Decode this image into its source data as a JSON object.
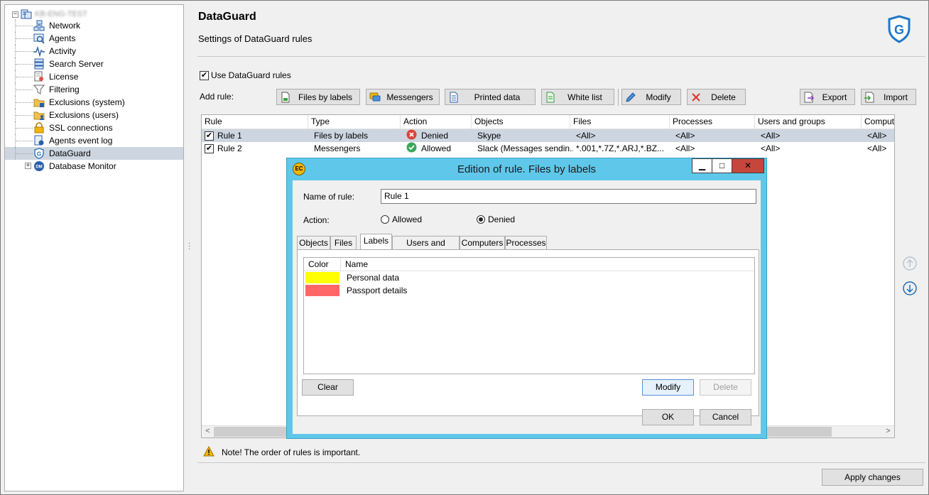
{
  "tree": {
    "root_label": "KB-ENG-TEST",
    "items": [
      {
        "label": "Network",
        "icon": "network-icon"
      },
      {
        "label": "Agents",
        "icon": "agents-icon"
      },
      {
        "label": "Activity",
        "icon": "activity-icon"
      },
      {
        "label": "Search Server",
        "icon": "search-server-icon"
      },
      {
        "label": "License",
        "icon": "license-icon"
      },
      {
        "label": "Filtering",
        "icon": "filter-icon"
      },
      {
        "label": "Exclusions (system)",
        "icon": "exclusions-system-icon"
      },
      {
        "label": "Exclusions (users)",
        "icon": "exclusions-users-icon"
      },
      {
        "label": "SSL connections",
        "icon": "lock-icon"
      },
      {
        "label": "Agents event log",
        "icon": "event-log-icon"
      },
      {
        "label": "DataGuard",
        "icon": "dataguard-icon",
        "selected": true
      },
      {
        "label": "Database Monitor",
        "icon": "database-monitor-icon"
      }
    ]
  },
  "header": {
    "title": "DataGuard",
    "subtitle": "Settings of DataGuard rules"
  },
  "use_rules": {
    "label": "Use DataGuard rules",
    "checked": true
  },
  "toolbar": {
    "add_rule_label": "Add rule:",
    "files_by_labels": "Files by labels",
    "messengers": "Messengers",
    "printed_data": "Printed data",
    "white_list": "White list",
    "modify": "Modify",
    "delete": "Delete",
    "export": "Export",
    "import": "Import"
  },
  "rules_table": {
    "columns": [
      "Rule",
      "Type",
      "Action",
      "Objects",
      "Files",
      "Processes",
      "Users and groups",
      "Compute"
    ],
    "rows": [
      {
        "rule": "Rule 1",
        "type": "Files by labels",
        "action": "Denied",
        "objects": "Skype",
        "files": "<All>",
        "processes": "<All>",
        "users": "<All>",
        "computers": "<All>"
      },
      {
        "rule": "Rule 2",
        "type": "Messengers",
        "action": "Allowed",
        "objects": "Slack (Messages sendin...",
        "files": "*.001,*.7Z,*.ARJ,*.BZ...",
        "processes": "<All>",
        "users": "<All>",
        "computers": "<All>"
      }
    ]
  },
  "note": "Note! The order of rules is important.",
  "apply_label": "Apply changes",
  "dialog": {
    "title": "Edition of rule. Files by labels",
    "icon_text": "EC",
    "name_label": "Name of rule:",
    "name_value": "Rule 1",
    "action_label": "Action:",
    "allowed_label": "Allowed",
    "denied_label": "Denied",
    "selected_action": "Denied",
    "tabs": [
      "Objects",
      "Files",
      "Labels",
      "Users and groups",
      "Computers",
      "Processes"
    ],
    "active_tab": "Labels",
    "labels_columns": [
      "Color",
      "Name"
    ],
    "labels": [
      {
        "color": "#ffff00",
        "name": "Personal data"
      },
      {
        "color": "#ff6666",
        "name": "Passport details"
      }
    ],
    "clear_label": "Clear",
    "modify_label": "Modify",
    "delete_label": "Delete",
    "ok_label": "OK",
    "cancel_label": "Cancel"
  }
}
